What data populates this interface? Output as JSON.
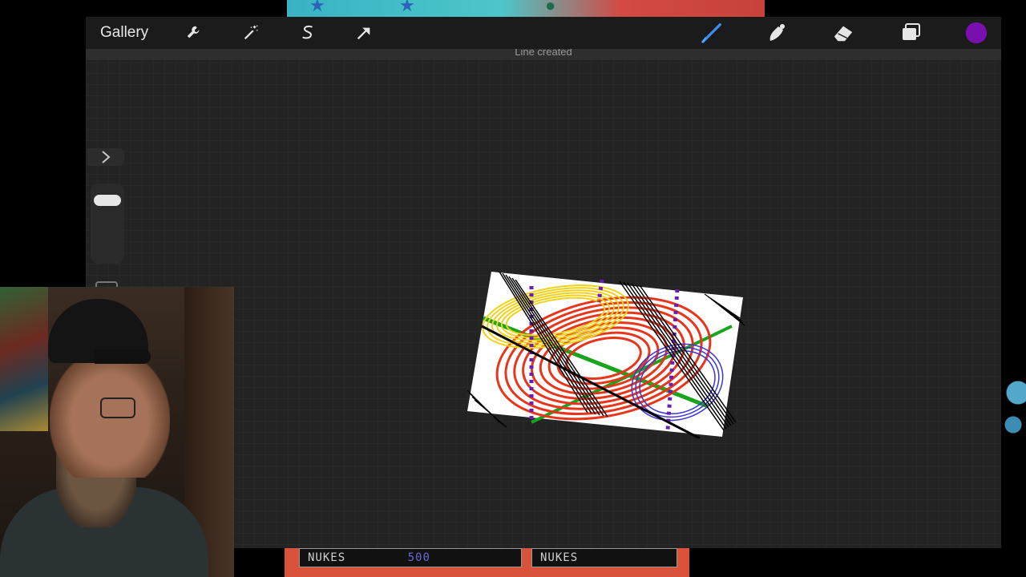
{
  "background": {
    "bottom_panels": [
      {
        "label": "NUKES",
        "score": "500"
      },
      {
        "label": "NUKES",
        "score": ""
      }
    ]
  },
  "app": {
    "gallery_label": "Gallery",
    "status_message": "Line created",
    "toolbar_left_icons": [
      "wrench-icon",
      "magic-wand-icon",
      "selection-icon",
      "transform-arrow-icon"
    ],
    "toolbar_right_icons": [
      "brush-icon",
      "smudge-icon",
      "eraser-icon",
      "layers-icon"
    ],
    "current_color": "#7a0fb0",
    "accent_color": "#3a8ef0"
  },
  "colors": {
    "red": "#e8361c",
    "yellow": "#f0d21c",
    "green": "#19a51b",
    "blue": "#3b35d6",
    "purple": "#6a1fb0",
    "black": "#000000"
  }
}
